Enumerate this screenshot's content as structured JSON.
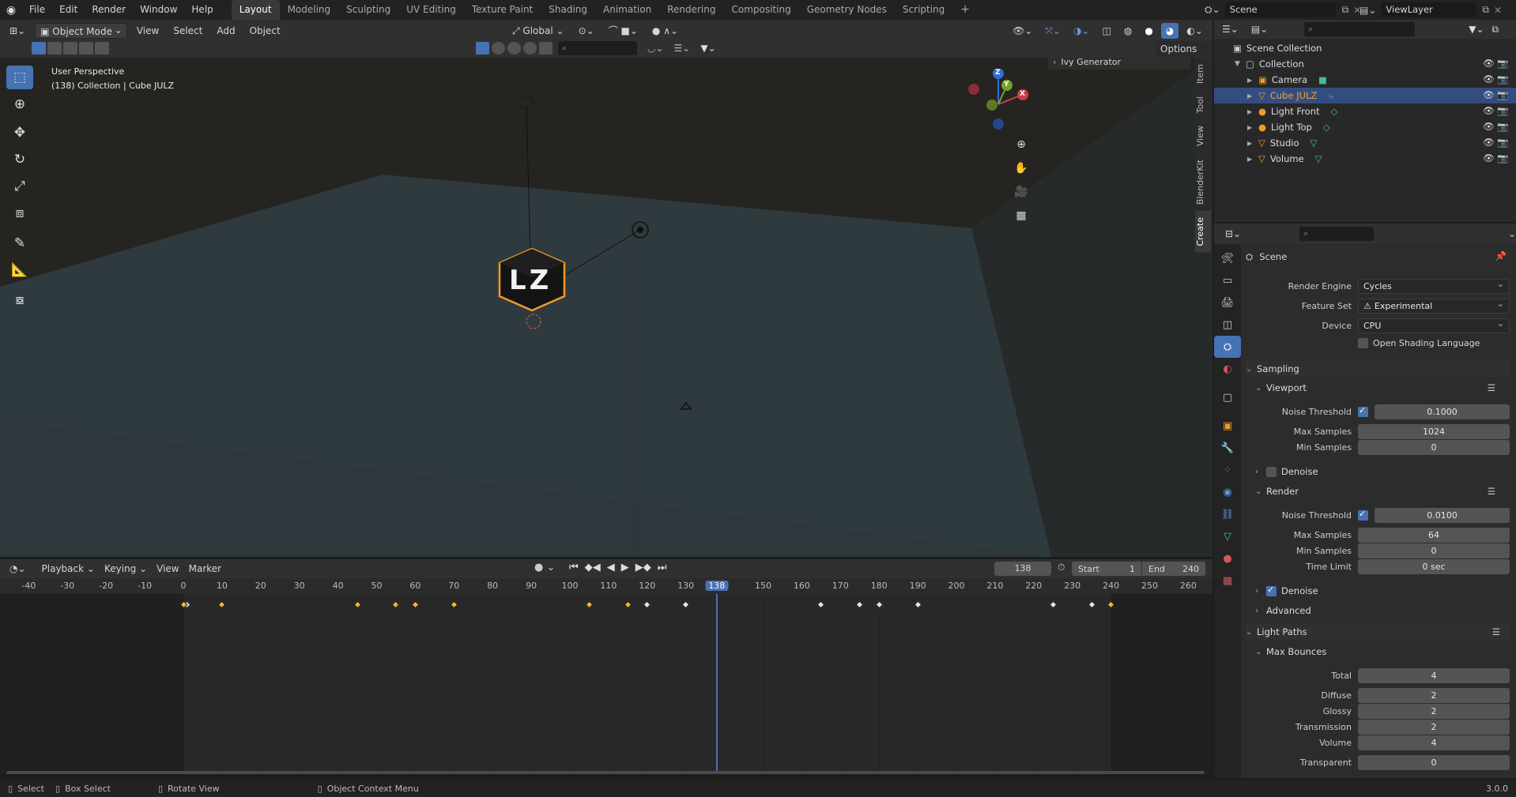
{
  "topbar": {
    "menus": [
      "File",
      "Edit",
      "Render",
      "Window",
      "Help"
    ],
    "workspaces": [
      "Layout",
      "Modeling",
      "Sculpting",
      "UV Editing",
      "Texture Paint",
      "Shading",
      "Animation",
      "Rendering",
      "Compositing",
      "Geometry Nodes",
      "Scripting"
    ],
    "active_workspace": "Layout",
    "add_tab": "+",
    "scene": "Scene",
    "view_layer": "ViewLayer"
  },
  "viewport_header": {
    "mode": "Object Mode",
    "menus": [
      "View",
      "Select",
      "Add",
      "Object"
    ],
    "orientation": "Global",
    "options": "Options"
  },
  "viewport": {
    "perspective": "User Perspective",
    "collection_info": "(138) Collection | Cube JULZ",
    "cube_text": "LZ",
    "ivy_generator": "Ivy Generator",
    "side_tabs": [
      "Item",
      "Tool",
      "View",
      "BlenderKit",
      "Create"
    ],
    "gizmo": {
      "x": "X",
      "y": "Y",
      "z": "Z"
    }
  },
  "timeline_header": {
    "menus": [
      "Playback",
      "Keying",
      "View",
      "Marker"
    ],
    "current_frame": "138",
    "start_label": "Start",
    "start_value": "1",
    "end_label": "End",
    "end_value": "240"
  },
  "timeline": {
    "ticks": [
      "-40",
      "-30",
      "-20",
      "-10",
      "0",
      "10",
      "20",
      "30",
      "40",
      "50",
      "60",
      "70",
      "80",
      "90",
      "100",
      "110",
      "120",
      "130",
      "138",
      "150",
      "160",
      "170",
      "180",
      "190",
      "200",
      "210",
      "220",
      "230",
      "240",
      "250",
      "260"
    ],
    "playhead_frame": 138,
    "keyframes_selected": [
      0,
      10,
      45,
      55,
      60,
      70,
      105,
      115,
      240
    ],
    "keyframes_unselected": [
      1,
      120,
      130,
      165,
      175,
      180,
      190,
      225,
      235
    ]
  },
  "outliner": {
    "root": "Scene Collection",
    "collection": "Collection",
    "items": [
      "Camera",
      "Cube JULZ",
      "Light Front",
      "Light Top",
      "Studio",
      "Volume"
    ],
    "selected": "Cube JULZ"
  },
  "properties": {
    "context": "Scene",
    "render_engine_label": "Render Engine",
    "render_engine": "Cycles",
    "feature_set_label": "Feature Set",
    "feature_set": "Experimental",
    "device_label": "Device",
    "device": "CPU",
    "osl": "Open Shading Language",
    "sampling": "Sampling",
    "viewport": "Viewport",
    "noise_threshold_label": "Noise Threshold",
    "vp_noise_threshold": "0.1000",
    "max_samples_label": "Max Samples",
    "vp_max_samples": "1024",
    "min_samples_label": "Min Samples",
    "vp_min_samples": "0",
    "denoise": "Denoise",
    "render": "Render",
    "r_noise_threshold": "0.0100",
    "r_max_samples": "64",
    "r_min_samples": "0",
    "time_limit_label": "Time Limit",
    "time_limit": "0 sec",
    "advanced": "Advanced",
    "light_paths": "Light Paths",
    "max_bounces": "Max Bounces",
    "total_label": "Total",
    "total": "4",
    "diffuse_label": "Diffuse",
    "diffuse": "2",
    "glossy_label": "Glossy",
    "glossy": "2",
    "transmission_label": "Transmission",
    "transmission": "2",
    "volume_label": "Volume",
    "volume": "4",
    "transparent_label": "Transparent",
    "transparent": "0"
  },
  "statusbar": {
    "select": "Select",
    "box_select": "Box Select",
    "rotate_view": "Rotate View",
    "context_menu": "Object Context Menu",
    "version": "3.0.0"
  },
  "colors": {
    "accent": "#4772b3",
    "selected_key": "#f5b331",
    "active_object": "#f09b2a"
  }
}
